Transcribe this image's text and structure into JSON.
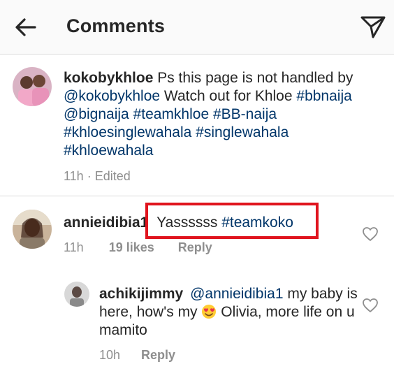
{
  "header": {
    "title": "Comments",
    "back_icon": "arrow-left-icon",
    "send_icon": "direct-send-icon"
  },
  "caption": {
    "username": "kokobykhloe",
    "text_1": " Ps this page is not handled by ",
    "mention": "@kokobykhloe",
    "text_2": "  Watch out for Khloe ",
    "hashtags": [
      "#bbnaija",
      "@bignaija",
      "#teamkhloe",
      "#BB-naija",
      "#khloesinglewahala",
      "#singlewahala",
      "#khloewahala"
    ],
    "meta": "11h · Edited"
  },
  "comments": [
    {
      "username": "annieidibia1",
      "text_1": "Yassssss ",
      "hashtag": "#teamkoko",
      "time": "11h",
      "likes": "19 likes",
      "reply": "Reply"
    },
    {
      "username": "achikijimmy",
      "mention": "@annieidibia1",
      "text_1": " my baby is here, how's my ",
      "emoji": "smiling-face-with-heart-eyes-emoji",
      "text_2": " Olivia, more life on u mamito",
      "time": "10h",
      "reply": "Reply"
    }
  ],
  "colors": {
    "link": "#003569",
    "meta": "#8e8e8e",
    "highlight": "#e0141e",
    "divider": "#dbdbdb"
  }
}
